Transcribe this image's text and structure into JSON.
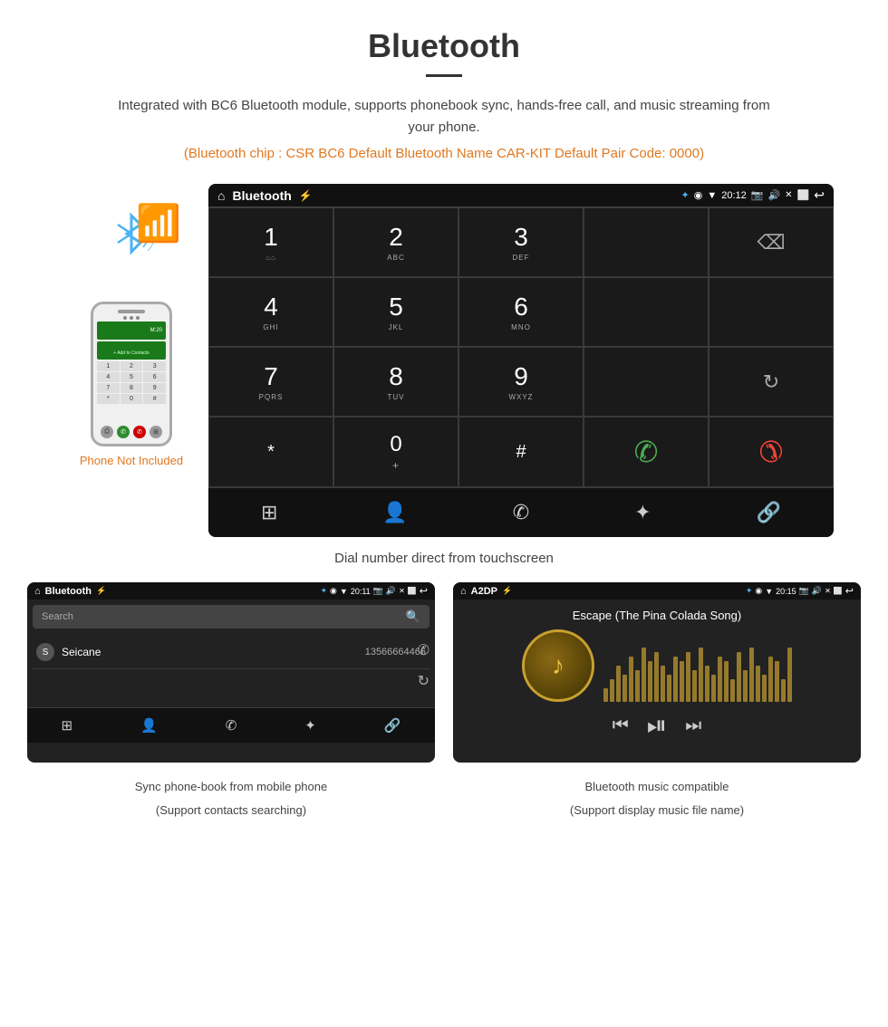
{
  "page": {
    "title": "Bluetooth",
    "description": "Integrated with BC6 Bluetooth module, supports phonebook sync, hands-free call, and music streaming from your phone.",
    "specs": "(Bluetooth chip : CSR BC6    Default Bluetooth Name CAR-KIT    Default Pair Code: 0000)",
    "phone_not_included": "Phone Not Included",
    "dial_caption": "Dial number direct from touchscreen",
    "contacts_caption_line1": "Sync phone-book from mobile phone",
    "contacts_caption_line2": "(Support contacts searching)",
    "music_caption_line1": "Bluetooth music compatible",
    "music_caption_line2": "(Support display music file name)"
  },
  "dial_screen": {
    "title": "Bluetooth",
    "time": "20:12",
    "keys": [
      {
        "num": "1",
        "sub": ""
      },
      {
        "num": "2",
        "sub": "ABC"
      },
      {
        "num": "3",
        "sub": "DEF"
      },
      {
        "num": "",
        "sub": ""
      },
      {
        "num": "",
        "sub": "backspace"
      },
      {
        "num": "4",
        "sub": "GHI"
      },
      {
        "num": "5",
        "sub": "JKL"
      },
      {
        "num": "6",
        "sub": "MNO"
      },
      {
        "num": "",
        "sub": ""
      },
      {
        "num": "",
        "sub": ""
      },
      {
        "num": "7",
        "sub": "PQRS"
      },
      {
        "num": "8",
        "sub": "TUV"
      },
      {
        "num": "9",
        "sub": "WXYZ"
      },
      {
        "num": "",
        "sub": ""
      },
      {
        "num": "",
        "sub": "refresh"
      },
      {
        "num": "*",
        "sub": ""
      },
      {
        "num": "0",
        "sub": "+"
      },
      {
        "num": "#",
        "sub": ""
      },
      {
        "num": "",
        "sub": "call"
      },
      {
        "num": "",
        "sub": "end"
      }
    ],
    "bottom_icons": [
      "dialpad",
      "contacts",
      "phone",
      "bluetooth",
      "link"
    ]
  },
  "contacts_screen": {
    "title": "Bluetooth",
    "time": "20:11",
    "search_placeholder": "Search",
    "contact": {
      "letter": "S",
      "name": "Seicane",
      "number": "13566664466"
    },
    "bottom_icons": [
      "dialpad",
      "person",
      "phone",
      "bluetooth",
      "link"
    ]
  },
  "music_screen": {
    "title": "A2DP",
    "time": "20:15",
    "song_title": "Escape (The Pina Colada Song)",
    "controls": [
      "prev",
      "play-pause",
      "next"
    ],
    "vis_heights": [
      15,
      25,
      40,
      30,
      50,
      35,
      60,
      45,
      55,
      40,
      30,
      50,
      45,
      35,
      55,
      25,
      60,
      50,
      40,
      30,
      45,
      55,
      35,
      60,
      40,
      30,
      50,
      45,
      25,
      60
    ]
  }
}
